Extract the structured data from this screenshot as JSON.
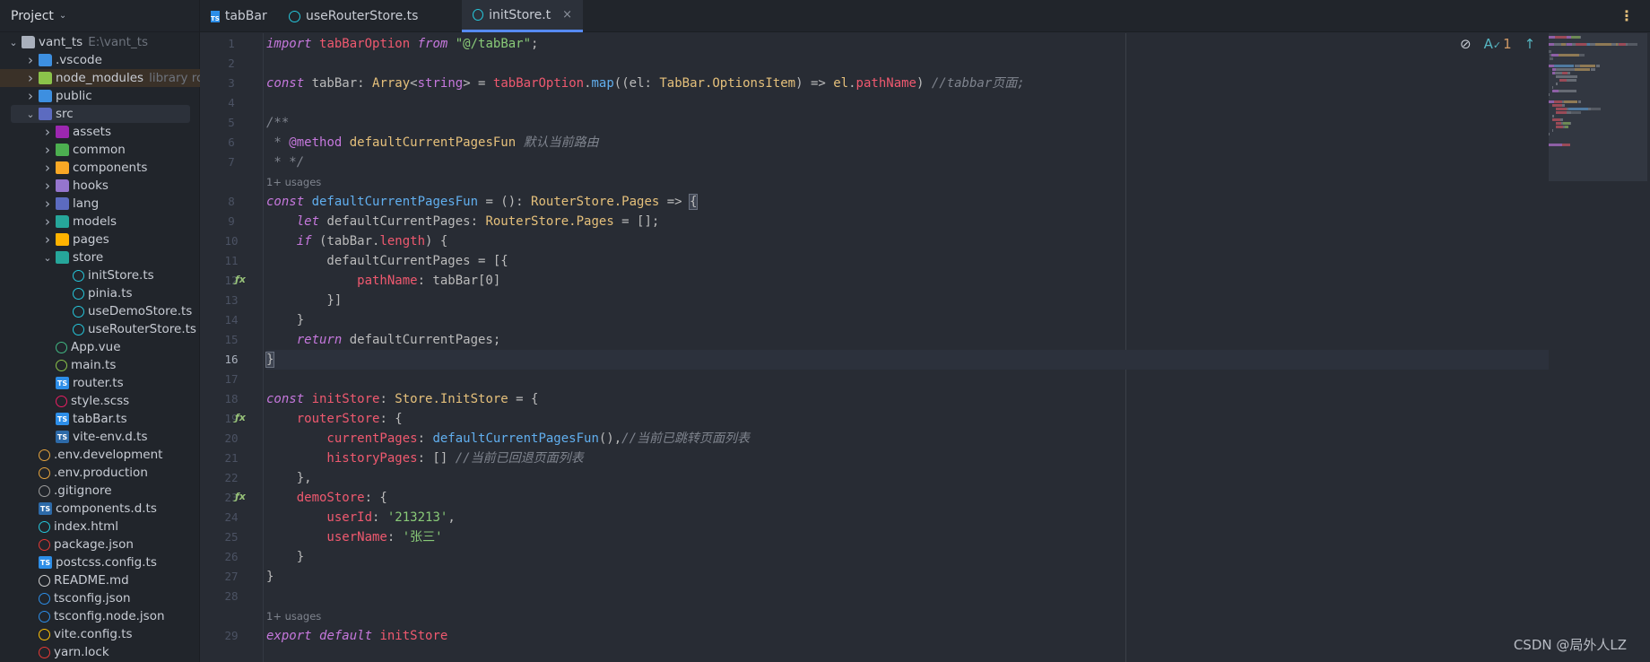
{
  "sidebar": {
    "title": "Project",
    "items": [
      {
        "label": "vant_ts",
        "hint": "E:\\vant_ts",
        "depth": 0,
        "arrow": "down",
        "icon": "folder-icon",
        "color": "#a9b0bc"
      },
      {
        "label": ".vscode",
        "depth": 1,
        "arrow": "right",
        "icon": "folder-icon",
        "color": "#3d8fe0"
      },
      {
        "label": "node_modules",
        "hint": "library root",
        "depth": 1,
        "arrow": "right",
        "icon": "folder-icon",
        "color": "#8bc34a",
        "lib": true
      },
      {
        "label": "public",
        "depth": 1,
        "arrow": "right",
        "icon": "folder-icon",
        "color": "#3d8fe0"
      },
      {
        "label": "src",
        "depth": 1,
        "arrow": "down",
        "icon": "folder-icon",
        "color": "#5c6bc0",
        "selected": true
      },
      {
        "label": "assets",
        "depth": 2,
        "arrow": "right",
        "icon": "folder-icon",
        "color": "#9c27b0"
      },
      {
        "label": "common",
        "depth": 2,
        "arrow": "right",
        "icon": "folder-icon",
        "color": "#4caf50"
      },
      {
        "label": "components",
        "depth": 2,
        "arrow": "right",
        "icon": "folder-icon",
        "color": "#f9a825"
      },
      {
        "label": "hooks",
        "depth": 2,
        "arrow": "right",
        "icon": "folder-icon",
        "color": "#9575cd"
      },
      {
        "label": "lang",
        "depth": 2,
        "arrow": "right",
        "icon": "folder-icon",
        "color": "#5c6bc0"
      },
      {
        "label": "models",
        "depth": 2,
        "arrow": "right",
        "icon": "folder-icon",
        "color": "#26a69a"
      },
      {
        "label": "pages",
        "depth": 2,
        "arrow": "right",
        "icon": "folder-icon",
        "color": "#ffb300"
      },
      {
        "label": "store",
        "depth": 2,
        "arrow": "down",
        "icon": "folder-icon",
        "color": "#26a69a"
      },
      {
        "label": "initStore.ts",
        "depth": 3,
        "icon": "pinia-icon",
        "color": "#26c6da"
      },
      {
        "label": "pinia.ts",
        "depth": 3,
        "icon": "pinia-icon",
        "color": "#26c6da"
      },
      {
        "label": "useDemoStore.ts",
        "depth": 3,
        "icon": "pinia-icon",
        "color": "#26c6da"
      },
      {
        "label": "useRouterStore.ts",
        "depth": 3,
        "icon": "pinia-icon",
        "color": "#26c6da"
      },
      {
        "label": "App.vue",
        "depth": 2,
        "icon": "vue-icon",
        "color": "#41b883"
      },
      {
        "label": "main.ts",
        "depth": 2,
        "icon": "nodejs-icon",
        "color": "#8bc34a"
      },
      {
        "label": "router.ts",
        "depth": 2,
        "icon": "typescript-icon",
        "color": "#2d8ee8"
      },
      {
        "label": "style.scss",
        "depth": 2,
        "icon": "sass-icon",
        "color": "#e91e63"
      },
      {
        "label": "tabBar.ts",
        "depth": 2,
        "icon": "typescript-icon",
        "color": "#2d8ee8"
      },
      {
        "label": "vite-env.d.ts",
        "depth": 2,
        "icon": "typescript-def-icon",
        "color": "#2d6aa8"
      },
      {
        "label": ".env.development",
        "depth": 1,
        "icon": "env-icon",
        "color": "#e5a33d"
      },
      {
        "label": ".env.production",
        "depth": 1,
        "icon": "env-icon",
        "color": "#e5a33d"
      },
      {
        "label": ".gitignore",
        "depth": 1,
        "icon": "git-icon",
        "color": "#9e9e9e"
      },
      {
        "label": "components.d.ts",
        "depth": 1,
        "icon": "typescript-def-icon",
        "color": "#2d6aa8"
      },
      {
        "label": "index.html",
        "depth": 1,
        "icon": "html-icon",
        "color": "#26c6da"
      },
      {
        "label": "package.json",
        "depth": 1,
        "icon": "npm-icon",
        "color": "#e53935"
      },
      {
        "label": "postcss.config.ts",
        "depth": 1,
        "icon": "typescript-icon",
        "color": "#2d8ee8"
      },
      {
        "label": "README.md",
        "depth": 1,
        "icon": "readme-icon",
        "color": "#d0d0d0"
      },
      {
        "label": "tsconfig.json",
        "depth": 1,
        "icon": "tsconfig-icon",
        "color": "#2d8ee8"
      },
      {
        "label": "tsconfig.node.json",
        "depth": 1,
        "icon": "tsconfig-icon",
        "color": "#2d8ee8"
      },
      {
        "label": "vite.config.ts",
        "depth": 1,
        "icon": "vite-icon",
        "color": "#ffc107"
      },
      {
        "label": "yarn.lock",
        "depth": 1,
        "icon": "lock-icon",
        "color": "#e53935"
      }
    ]
  },
  "tabs": [
    {
      "label": "tabBar.ts",
      "icon": "typescript-icon",
      "active": false
    },
    {
      "label": "useRouterStore.ts",
      "icon": "pinia-icon",
      "active": false
    },
    {
      "label": "initStore.ts",
      "icon": "pinia-icon",
      "active": true,
      "close": "×"
    }
  ],
  "toolbar": {
    "inspection_count": "1",
    "more": "⋮"
  },
  "usage_hint": "1+ usages",
  "current_line": 16,
  "code": [
    {
      "n": 1,
      "t": [
        [
          "import ",
          "kw"
        ],
        [
          "tabBarOption ",
          "id"
        ],
        [
          "from ",
          "kw"
        ],
        [
          "\"@/tabBar\"",
          "st"
        ],
        [
          ";",
          "pl"
        ]
      ]
    },
    {
      "n": 2,
      "t": []
    },
    {
      "n": 3,
      "t": [
        [
          "const ",
          "kw"
        ],
        [
          "tabBar",
          "pl"
        ],
        [
          ": ",
          "pl"
        ],
        [
          "Array",
          "ty"
        ],
        [
          "<",
          "pl"
        ],
        [
          "string",
          "tg"
        ],
        [
          "> = ",
          "pl"
        ],
        [
          "tabBarOption",
          "id"
        ],
        [
          ".",
          "pl"
        ],
        [
          "map",
          "fn"
        ],
        [
          "((el: ",
          "pl"
        ],
        [
          "TabBar.OptionsItem",
          "ty"
        ],
        [
          ") => ",
          "pl"
        ],
        [
          "el",
          "ty"
        ],
        [
          ".",
          "pl"
        ],
        [
          "pathName",
          "id"
        ],
        [
          ") ",
          "pl"
        ],
        [
          "//tabbar页面;",
          "cm"
        ]
      ]
    },
    {
      "n": 4,
      "t": []
    },
    {
      "n": 5,
      "t": [
        [
          "/**",
          "cm"
        ]
      ]
    },
    {
      "n": 6,
      "t": [
        [
          " * ",
          "cm"
        ],
        [
          "@method ",
          "tg"
        ],
        [
          "defaultCurrentPagesFun ",
          "ty"
        ],
        [
          "默认当前路由",
          "cm"
        ]
      ]
    },
    {
      "n": 7,
      "t": [
        [
          " * */",
          "cm"
        ]
      ]
    },
    {
      "usage": true
    },
    {
      "n": 8,
      "t": [
        [
          "const ",
          "kw"
        ],
        [
          "defaultCurrentPagesFun",
          "fn"
        ],
        [
          " = (): ",
          "pl"
        ],
        [
          "RouterStore.Pages",
          "ty"
        ],
        [
          " => ",
          "pl"
        ],
        [
          "{",
          "br"
        ]
      ]
    },
    {
      "n": 9,
      "t": [
        [
          "    let ",
          "kw"
        ],
        [
          "defaultCurrentPages",
          "pl"
        ],
        [
          ": ",
          "pl"
        ],
        [
          "RouterStore.Pages",
          "ty"
        ],
        [
          " = [];",
          "pl"
        ]
      ]
    },
    {
      "n": 10,
      "t": [
        [
          "    if ",
          "kw"
        ],
        [
          "(tabBar.",
          "pl"
        ],
        [
          "length",
          "id"
        ],
        [
          ") {",
          "pl"
        ]
      ]
    },
    {
      "n": 11,
      "t": [
        [
          "        defaultCurrentPages = [{",
          "pl"
        ]
      ]
    },
    {
      "n": 12,
      "t": [
        [
          "            pathName",
          "id"
        ],
        [
          ": tabBar[0]",
          "pl"
        ]
      ],
      "fx": true
    },
    {
      "n": 13,
      "t": [
        [
          "        }]",
          "pl"
        ]
      ]
    },
    {
      "n": 14,
      "t": [
        [
          "    }",
          "pl"
        ]
      ]
    },
    {
      "n": 15,
      "t": [
        [
          "    return ",
          "kw"
        ],
        [
          "defaultCurrentPages;",
          "pl"
        ]
      ]
    },
    {
      "n": 16,
      "t": [
        [
          "}",
          "br"
        ]
      ]
    },
    {
      "n": 17,
      "t": []
    },
    {
      "n": 18,
      "t": [
        [
          "const ",
          "kw"
        ],
        [
          "initStore",
          "id"
        ],
        [
          ": ",
          "pl"
        ],
        [
          "Store.InitStore",
          "ty"
        ],
        [
          " = {",
          "pl"
        ]
      ]
    },
    {
      "n": 19,
      "t": [
        [
          "    routerStore",
          "id"
        ],
        [
          ": {",
          "pl"
        ]
      ],
      "fx": true
    },
    {
      "n": 20,
      "t": [
        [
          "        currentPages",
          "id"
        ],
        [
          ": ",
          "pl"
        ],
        [
          "defaultCurrentPagesFun",
          "fn"
        ],
        [
          "(),",
          "pl"
        ],
        [
          "//当前已跳转页面列表",
          "cm"
        ]
      ]
    },
    {
      "n": 21,
      "t": [
        [
          "        historyPages",
          "id"
        ],
        [
          ": [] ",
          "pl"
        ],
        [
          "//当前已回退页面列表",
          "cm"
        ]
      ]
    },
    {
      "n": 22,
      "t": [
        [
          "    },",
          "pl"
        ]
      ]
    },
    {
      "n": 23,
      "t": [
        [
          "    demoStore",
          "id"
        ],
        [
          ": {",
          "pl"
        ]
      ],
      "fx": true
    },
    {
      "n": 24,
      "t": [
        [
          "        userId",
          "id"
        ],
        [
          ": ",
          "pl"
        ],
        [
          "'213213'",
          "st"
        ],
        [
          ",",
          "pl"
        ]
      ]
    },
    {
      "n": 25,
      "t": [
        [
          "        userName",
          "id"
        ],
        [
          ": ",
          "pl"
        ],
        [
          "'张三'",
          "st"
        ]
      ]
    },
    {
      "n": 26,
      "t": [
        [
          "    }",
          "pl"
        ]
      ]
    },
    {
      "n": 27,
      "t": [
        [
          "}",
          "pl"
        ]
      ]
    },
    {
      "n": 28,
      "t": []
    },
    {
      "usage": true
    },
    {
      "n": 29,
      "t": [
        [
          "export ",
          "kw"
        ],
        [
          "default ",
          "kw"
        ],
        [
          "initStore",
          "id"
        ]
      ]
    }
  ],
  "watermark": "CSDN @局外人LZ"
}
